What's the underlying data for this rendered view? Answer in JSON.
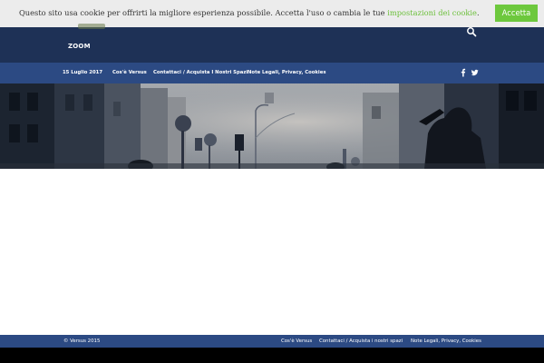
{
  "cookie_banner": {
    "text_before": "Questo sito usa cookie  per offrirti la migliore esperienza possibile. Accetta l'uso o cambia le tue ",
    "link_label": "impostazioni dei cookie",
    "text_after": ".",
    "accept_label": "Accetta"
  },
  "header": {
    "nav_item": "ZOOM"
  },
  "topbar": {
    "date": "15 Luglio 2017",
    "menu": [
      "Cos'è Versus",
      "Contattaci / Acquista I Nostri Spazi",
      "Note Legali, Privacy, Cookies"
    ]
  },
  "footer": {
    "copyright": "© Versus 2015",
    "links": [
      "Cos'è Versus",
      "Contattaci / Acquista i nostri spazi",
      "Note Legali, Privacy, Cookies"
    ]
  },
  "colors": {
    "header": "#1e3156",
    "topbar": "#2c4a83",
    "accept": "#6dc83d",
    "cookie_link": "#6bbf3a"
  },
  "icons": {
    "search": "search-icon",
    "facebook": "facebook-icon",
    "twitter": "twitter-icon"
  }
}
